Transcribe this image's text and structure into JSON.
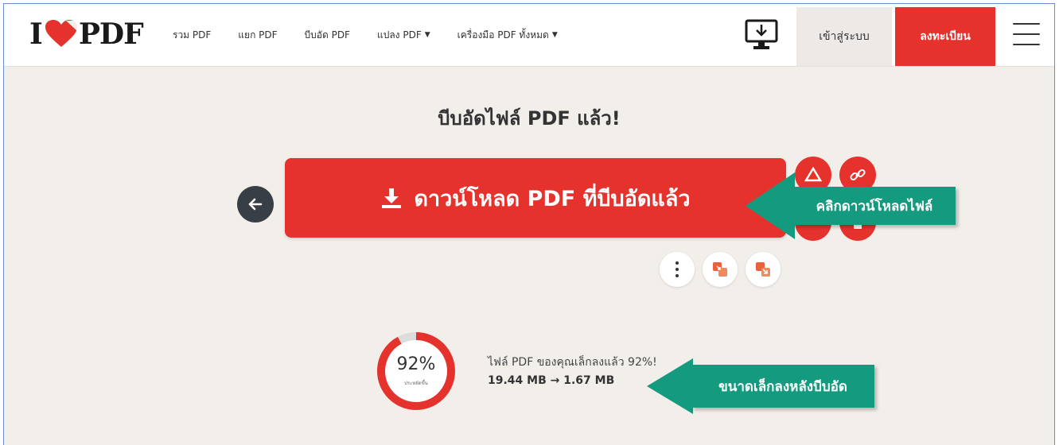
{
  "header": {
    "logo": {
      "left_text": "I",
      "right_text": "PDF"
    },
    "nav": [
      {
        "label": "รวม PDF",
        "caret": ""
      },
      {
        "label": "แยก PDF",
        "caret": ""
      },
      {
        "label": "บีบอัด PDF",
        "caret": ""
      },
      {
        "label": "แปลง PDF",
        "caret": "▼"
      },
      {
        "label": "เครื่องมือ PDF ทั้งหมด",
        "caret": "▼"
      }
    ],
    "desktop_icon": "desktop-download-icon",
    "login_label": "เข้าสู่ระบบ",
    "register_label": "ลงทะเบียน",
    "menu_icon": "hamburger-menu-icon"
  },
  "main": {
    "title": "บีบอัดไฟล์ PDF แล้ว!",
    "download_label": "ดาวน์โหลด PDF ที่บีบอัดแล้ว",
    "download_icon": "download-icon",
    "back_icon": "arrow-left-icon",
    "side_icons": [
      "google-drive-icon",
      "link-icon",
      "dropbox-icon",
      "trash-icon"
    ],
    "more_icon": "more-vertical-icon",
    "tool_icons": [
      "compress-icon",
      "expand-icon"
    ],
    "callout_download": "คลิกดาวน์โหลดไฟล์",
    "progress": {
      "value_label": "92%",
      "fraction": 0.92,
      "caption": "ประหยัดขึ้น"
    },
    "result_text": "ไฟล์ PDF ของคุณเล็กลงแล้ว 92%!",
    "size_text": "19.44 MB → 1.67 MB",
    "callout_size": "ขนาดเล็กลงหลังบีบอัด"
  },
  "colors": {
    "brand_red": "#e5322d",
    "callout_green": "#149a7e",
    "background": "#f2efeb",
    "dark": "#383e45"
  }
}
